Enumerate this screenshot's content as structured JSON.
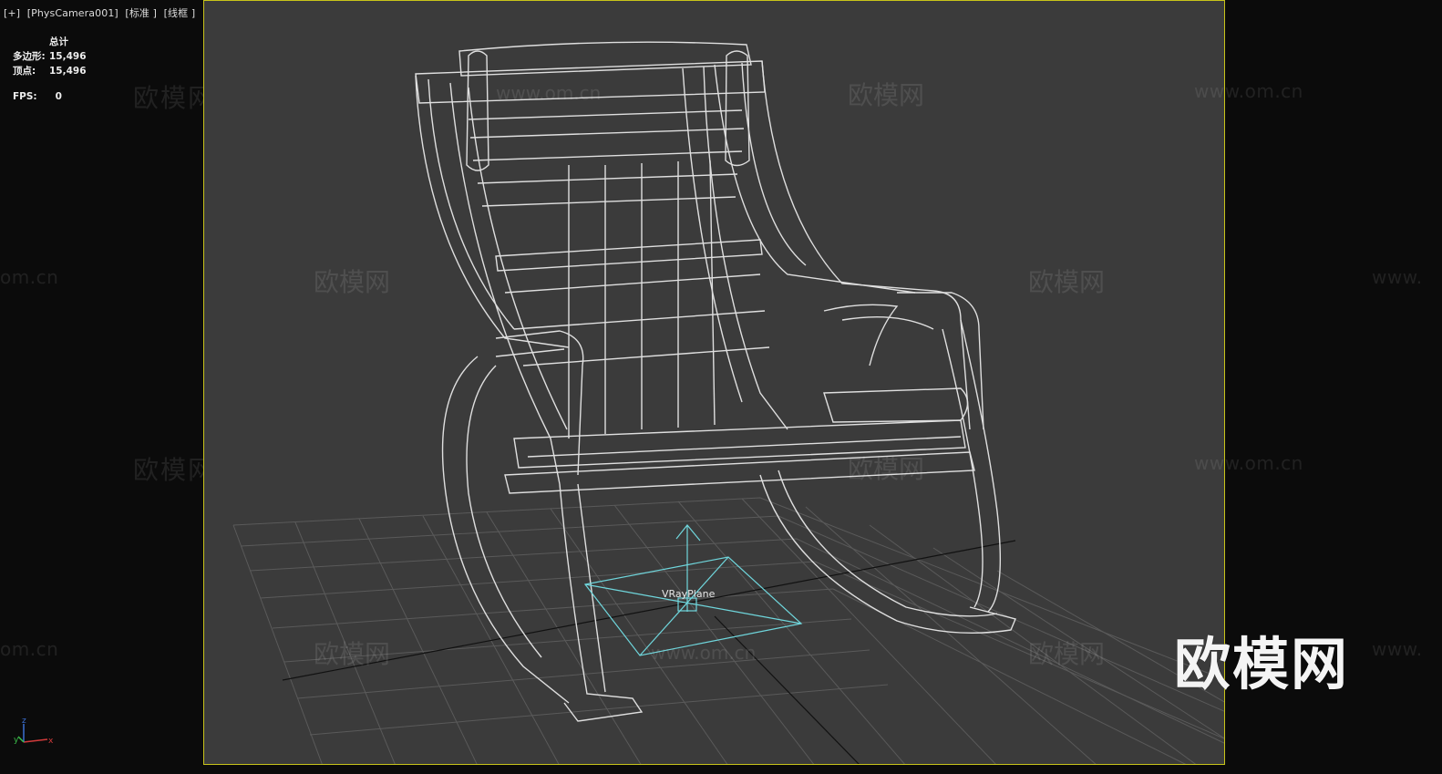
{
  "viewport": {
    "labels": [
      "[+]",
      "[PhysCamera001]",
      "[标准 ]",
      "[线框 ]"
    ]
  },
  "stats": {
    "header": "总计",
    "polygons_label": "多边形:",
    "polygons_value": "15,496",
    "vertices_label": "顶点:",
    "vertices_value": "15,496",
    "fps_label": "FPS:",
    "fps_value": "0"
  },
  "scene": {
    "object_label": "VRayPlane",
    "colors": {
      "frame_border": "#c8c41a",
      "viewport_bg": "#3b3b3b",
      "wireframe": "#e8e8e8",
      "selected_object": "#6fd6dc"
    }
  },
  "watermarks": {
    "brand_cn": "欧模网",
    "brand_url": "www.om.cn",
    "brand_url_partial_left": "om.cn",
    "brand_url_partial_right": "www.",
    "logo": "欧模网"
  },
  "axis_gizmo": {
    "x": "x",
    "y": "y",
    "z": "z"
  }
}
